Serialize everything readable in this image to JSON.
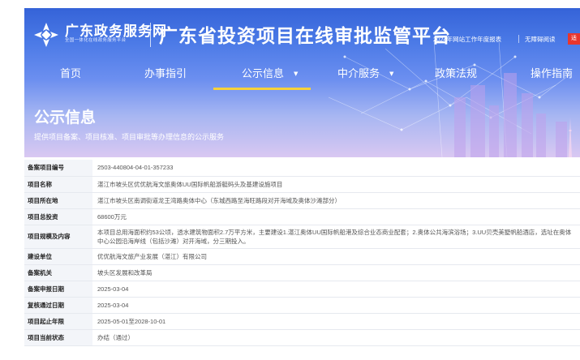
{
  "header": {
    "site_name": "广东政务服务网",
    "site_sub": "全国一体化在线政务服务平台",
    "platform_title": "广东省投资项目在线审批监管平台",
    "report_link": "2024年网站工作年度报表",
    "access_link": "无障碍阅读",
    "edge_badge": "适"
  },
  "nav": {
    "items": [
      {
        "label": "首页"
      },
      {
        "label": "办事指引"
      },
      {
        "label": "公示信息",
        "dropdown": "▼"
      },
      {
        "label": "中介服务",
        "dropdown": "▼"
      },
      {
        "label": "政策法规"
      },
      {
        "label": "操作指南"
      }
    ]
  },
  "section": {
    "title": "公示信息",
    "desc": "提供项目备案、项目核准、项目审批等办理信息的公示服务"
  },
  "details": {
    "rows": [
      {
        "k": "备案项目编号",
        "v": "2503-440804-04-01-357233"
      },
      {
        "k": "项目名称",
        "v": "湛江市坡头区优优航海文旅奥体UU国际帆船游艇码头及基建设施项目"
      },
      {
        "k": "项目所在地",
        "v": "湛江市坡头区南调街道龙王湾路奥体中心（东城西路至海旺路段对开海域及奥体沙滩部分）"
      },
      {
        "k": "项目总投资",
        "v": "68600万元"
      },
      {
        "k": "项目规模及内容",
        "v": "本项目总用海面积约53公顷，透水建筑物面积2.7万平方米，主要建设1.湛江奥体UU国际帆船港及综合业态商业配套；2.奥体公共海滨浴场；3.UU贝壳美墅帆船酒店，选址在奥体中心公园沿海岸线（包括沙滩）对开海域，分三期投入。"
      },
      {
        "k": "建设单位",
        "v": "优优航海文旅产业发展（湛江）有限公司"
      },
      {
        "k": "备案机关",
        "v": "坡头区发展和改革局"
      },
      {
        "k": "备案申报日期",
        "v": "2025-03-04"
      },
      {
        "k": "复核通过日期",
        "v": "2025-03-04"
      },
      {
        "k": "项目起止年限",
        "v": "2025-05-01至2028-10-01"
      },
      {
        "k": "项目当前状态",
        "v": "办结（通过）"
      }
    ]
  },
  "colors": {
    "banner_top": "#3563d8",
    "banner_bottom": "#d9c8f2",
    "nav_active_underline": "#f7d23a",
    "label_bg": "#f3f5f9"
  },
  "icons": {
    "logo": "guangdong-gov-logo-icon"
  }
}
